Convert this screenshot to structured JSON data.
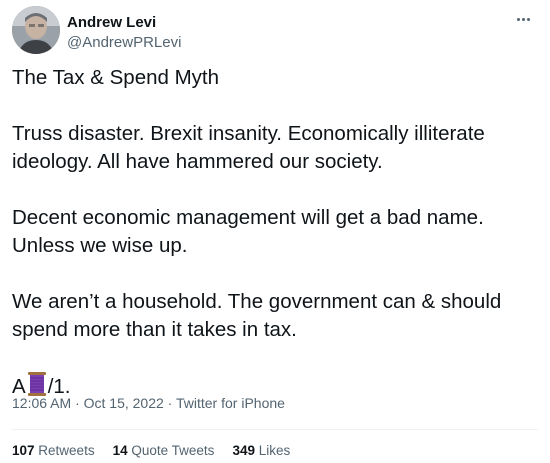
{
  "author": {
    "display_name": "Andrew Levi",
    "handle": "@AndrewPRLevi"
  },
  "tweet": {
    "title": "The Tax & Spend Myth",
    "para1": "Truss disaster. Brexit insanity. Economically illiterate ideology. All have hammered our society.",
    "para2": "Decent economic management will get a bad name. Unless we wise up.",
    "para3": "We aren’t a household. The government can & should spend more than it takes in tax.",
    "thread_prefix": "A",
    "thread_suffix": "/1.",
    "thread_emoji": "spool-of-thread-icon"
  },
  "meta": {
    "time": "12:06 AM",
    "sep1": " · ",
    "date": "Oct 15, 2022",
    "sep2": " · ",
    "source": "Twitter for iPhone"
  },
  "stats": {
    "retweets_count": "107",
    "retweets_label": "Retweets",
    "quote_count": "14",
    "quote_label": "Quote Tweets",
    "likes_count": "349",
    "likes_label": "Likes"
  },
  "colors": {
    "text": "#0f1419",
    "secondary": "#536471",
    "divider": "#eff3f4",
    "emoji_purple": "#7b3fb3"
  }
}
